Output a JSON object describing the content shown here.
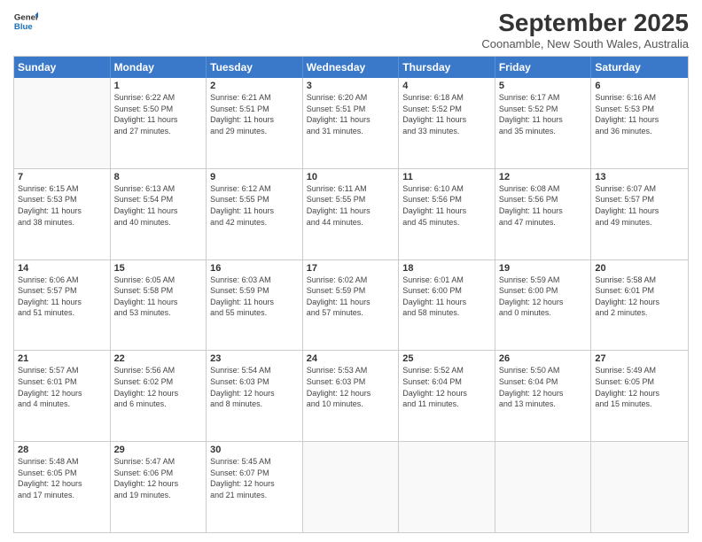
{
  "logo": {
    "line1": "General",
    "line2": "Blue"
  },
  "title": "September 2025",
  "subtitle": "Coonamble, New South Wales, Australia",
  "header_days": [
    "Sunday",
    "Monday",
    "Tuesday",
    "Wednesday",
    "Thursday",
    "Friday",
    "Saturday"
  ],
  "weeks": [
    [
      {
        "day": "",
        "text": ""
      },
      {
        "day": "1",
        "text": "Sunrise: 6:22 AM\nSunset: 5:50 PM\nDaylight: 11 hours\nand 27 minutes."
      },
      {
        "day": "2",
        "text": "Sunrise: 6:21 AM\nSunset: 5:51 PM\nDaylight: 11 hours\nand 29 minutes."
      },
      {
        "day": "3",
        "text": "Sunrise: 6:20 AM\nSunset: 5:51 PM\nDaylight: 11 hours\nand 31 minutes."
      },
      {
        "day": "4",
        "text": "Sunrise: 6:18 AM\nSunset: 5:52 PM\nDaylight: 11 hours\nand 33 minutes."
      },
      {
        "day": "5",
        "text": "Sunrise: 6:17 AM\nSunset: 5:52 PM\nDaylight: 11 hours\nand 35 minutes."
      },
      {
        "day": "6",
        "text": "Sunrise: 6:16 AM\nSunset: 5:53 PM\nDaylight: 11 hours\nand 36 minutes."
      }
    ],
    [
      {
        "day": "7",
        "text": "Sunrise: 6:15 AM\nSunset: 5:53 PM\nDaylight: 11 hours\nand 38 minutes."
      },
      {
        "day": "8",
        "text": "Sunrise: 6:13 AM\nSunset: 5:54 PM\nDaylight: 11 hours\nand 40 minutes."
      },
      {
        "day": "9",
        "text": "Sunrise: 6:12 AM\nSunset: 5:55 PM\nDaylight: 11 hours\nand 42 minutes."
      },
      {
        "day": "10",
        "text": "Sunrise: 6:11 AM\nSunset: 5:55 PM\nDaylight: 11 hours\nand 44 minutes."
      },
      {
        "day": "11",
        "text": "Sunrise: 6:10 AM\nSunset: 5:56 PM\nDaylight: 11 hours\nand 45 minutes."
      },
      {
        "day": "12",
        "text": "Sunrise: 6:08 AM\nSunset: 5:56 PM\nDaylight: 11 hours\nand 47 minutes."
      },
      {
        "day": "13",
        "text": "Sunrise: 6:07 AM\nSunset: 5:57 PM\nDaylight: 11 hours\nand 49 minutes."
      }
    ],
    [
      {
        "day": "14",
        "text": "Sunrise: 6:06 AM\nSunset: 5:57 PM\nDaylight: 11 hours\nand 51 minutes."
      },
      {
        "day": "15",
        "text": "Sunrise: 6:05 AM\nSunset: 5:58 PM\nDaylight: 11 hours\nand 53 minutes."
      },
      {
        "day": "16",
        "text": "Sunrise: 6:03 AM\nSunset: 5:59 PM\nDaylight: 11 hours\nand 55 minutes."
      },
      {
        "day": "17",
        "text": "Sunrise: 6:02 AM\nSunset: 5:59 PM\nDaylight: 11 hours\nand 57 minutes."
      },
      {
        "day": "18",
        "text": "Sunrise: 6:01 AM\nSunset: 6:00 PM\nDaylight: 11 hours\nand 58 minutes."
      },
      {
        "day": "19",
        "text": "Sunrise: 5:59 AM\nSunset: 6:00 PM\nDaylight: 12 hours\nand 0 minutes."
      },
      {
        "day": "20",
        "text": "Sunrise: 5:58 AM\nSunset: 6:01 PM\nDaylight: 12 hours\nand 2 minutes."
      }
    ],
    [
      {
        "day": "21",
        "text": "Sunrise: 5:57 AM\nSunset: 6:01 PM\nDaylight: 12 hours\nand 4 minutes."
      },
      {
        "day": "22",
        "text": "Sunrise: 5:56 AM\nSunset: 6:02 PM\nDaylight: 12 hours\nand 6 minutes."
      },
      {
        "day": "23",
        "text": "Sunrise: 5:54 AM\nSunset: 6:03 PM\nDaylight: 12 hours\nand 8 minutes."
      },
      {
        "day": "24",
        "text": "Sunrise: 5:53 AM\nSunset: 6:03 PM\nDaylight: 12 hours\nand 10 minutes."
      },
      {
        "day": "25",
        "text": "Sunrise: 5:52 AM\nSunset: 6:04 PM\nDaylight: 12 hours\nand 11 minutes."
      },
      {
        "day": "26",
        "text": "Sunrise: 5:50 AM\nSunset: 6:04 PM\nDaylight: 12 hours\nand 13 minutes."
      },
      {
        "day": "27",
        "text": "Sunrise: 5:49 AM\nSunset: 6:05 PM\nDaylight: 12 hours\nand 15 minutes."
      }
    ],
    [
      {
        "day": "28",
        "text": "Sunrise: 5:48 AM\nSunset: 6:05 PM\nDaylight: 12 hours\nand 17 minutes."
      },
      {
        "day": "29",
        "text": "Sunrise: 5:47 AM\nSunset: 6:06 PM\nDaylight: 12 hours\nand 19 minutes."
      },
      {
        "day": "30",
        "text": "Sunrise: 5:45 AM\nSunset: 6:07 PM\nDaylight: 12 hours\nand 21 minutes."
      },
      {
        "day": "",
        "text": ""
      },
      {
        "day": "",
        "text": ""
      },
      {
        "day": "",
        "text": ""
      },
      {
        "day": "",
        "text": ""
      }
    ]
  ]
}
